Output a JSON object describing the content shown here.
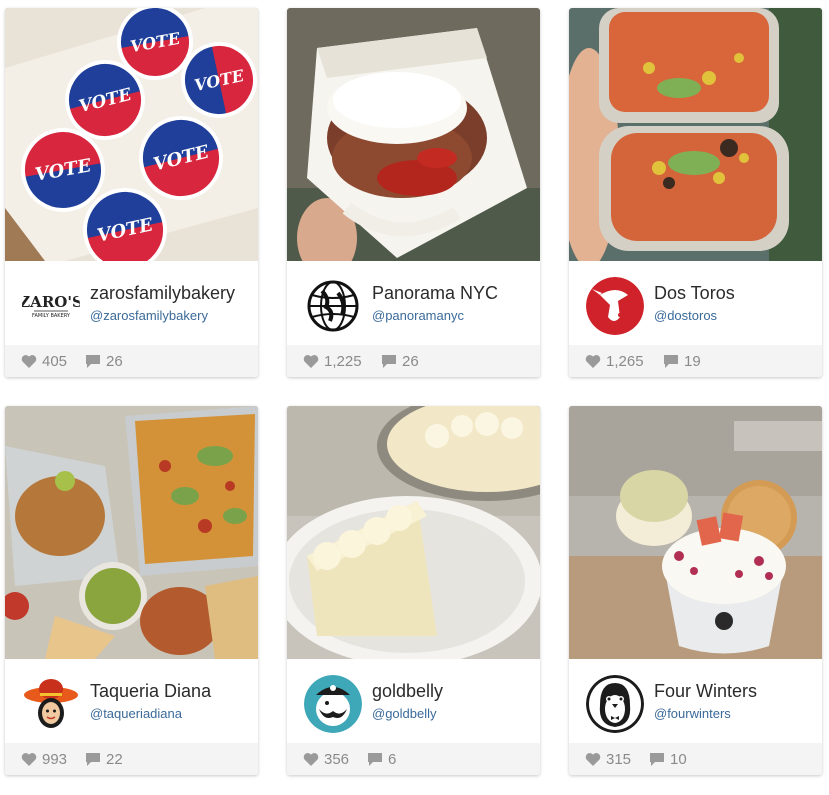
{
  "cards": [
    {
      "name": "zarosfamilybakery",
      "handle": "@zarosfamilybakery",
      "likes": "405",
      "comments": "26",
      "avatar": "zaros-logo",
      "photo": "vote-cookies"
    },
    {
      "name": "Panorama NYC",
      "handle": "@panoramanyc",
      "likes": "1,225",
      "comments": "26",
      "avatar": "globe-logo",
      "photo": "bao-bun"
    },
    {
      "name": "Dos Toros",
      "handle": "@dostoros",
      "likes": "1,265",
      "comments": "19",
      "avatar": "bull-logo",
      "photo": "burrito"
    },
    {
      "name": "Taqueria Diana",
      "handle": "@taqueriadiana",
      "likes": "993",
      "comments": "22",
      "avatar": "diana-logo",
      "photo": "nachos-spread"
    },
    {
      "name": "goldbelly",
      "handle": "@goldbelly",
      "likes": "356",
      "comments": "6",
      "avatar": "goldbelly-logo",
      "photo": "key-lime-pie"
    },
    {
      "name": "Four Winters",
      "handle": "@fourwinters",
      "likes": "315",
      "comments": "10",
      "avatar": "penguin-logo",
      "photo": "ice-cream-sundae"
    }
  ],
  "avatar_text": {
    "zaros": "ZARO'S",
    "zaros_sub": "FAMILY BAKERY",
    "vote": "VOTE"
  },
  "icons": {
    "like": "heart-icon",
    "comment": "comment-bubble-icon"
  },
  "colors": {
    "handle": "#3a6a9a",
    "stats_bg": "#f4f4f4",
    "stats_text": "#8a8a8a",
    "dos_toros_red": "#d0222a"
  }
}
